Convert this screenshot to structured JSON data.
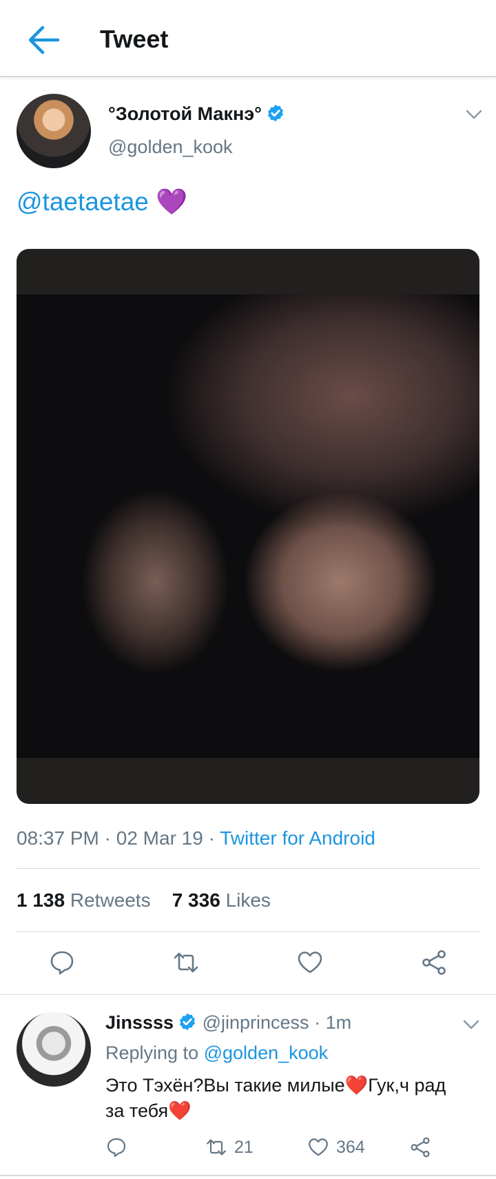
{
  "header": {
    "title": "Tweet"
  },
  "tweet": {
    "display_name": "°Золотой Макнэ°",
    "handle": "@golden_kook",
    "mention": "@taetaetae",
    "emoji": "💜",
    "time": "08:37 PM",
    "date": "02 Mar 19",
    "source": "Twitter for Android",
    "retweets_count": "1 138",
    "retweets_label": "Retweets",
    "likes_count": "7 336",
    "likes_label": "Likes"
  },
  "reply": {
    "display_name": "Jinssss",
    "handle": "@jinprincess",
    "time": "1m",
    "replying_label": "Replying to",
    "replying_to": "@golden_kook",
    "text": "Это Тэхён?Вы такие милые❤️Гук,ч рад за тебя❤️",
    "retweets": "21",
    "likes": "364"
  },
  "colors": {
    "accent": "#1b95e0",
    "secondary_text": "#657786",
    "verified": "#1da1f2"
  }
}
